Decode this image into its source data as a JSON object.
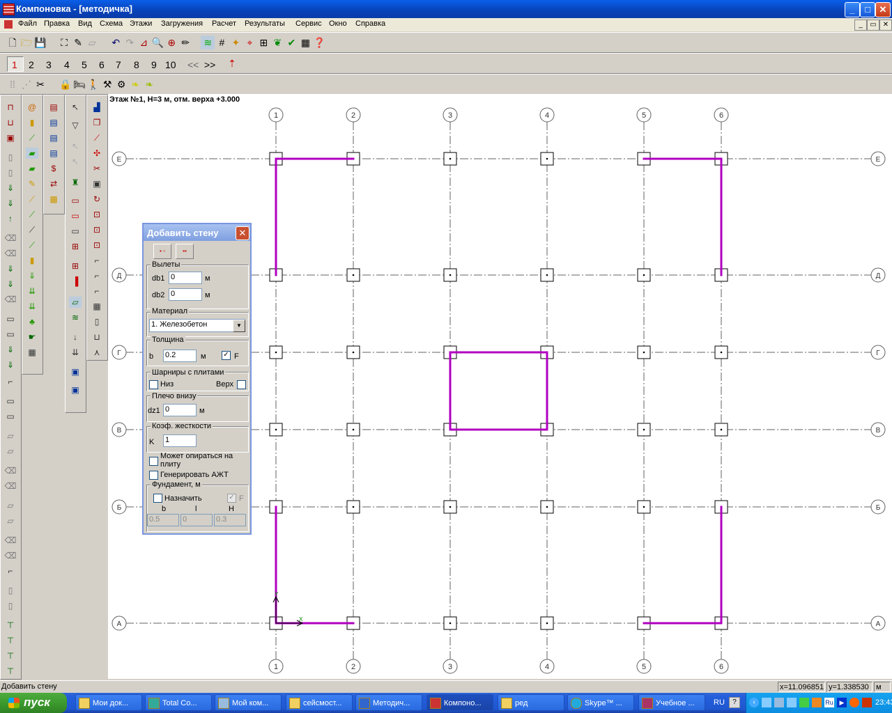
{
  "window": {
    "title": "Компоновка - [методичка]",
    "min": "_",
    "max": "□",
    "close": "✕"
  },
  "menu": [
    "Файл",
    "Правка",
    "Вид",
    "Схема",
    "Этажи",
    "Загружения",
    "Расчет",
    "Результаты",
    "Сервис",
    "Окно",
    "Справка"
  ],
  "floor_buttons": [
    "1",
    "2",
    "3",
    "4",
    "5",
    "6",
    "7",
    "8",
    "9",
    "10",
    "<<",
    ">>"
  ],
  "floor_info": "Этаж №1, H=3 м, отм. верха +3.000",
  "grid": {
    "x_axes": [
      "1",
      "2",
      "3",
      "4",
      "5",
      "6"
    ],
    "y_axes": [
      "Е",
      "Д",
      "Г",
      "В",
      "Б",
      "А"
    ],
    "wall_color": "#b000c0"
  },
  "dialog": {
    "title": "Добавить стену",
    "overhangs": {
      "label": "Вылеты",
      "db1_label": "db1",
      "db1": "0",
      "db2_label": "db2",
      "db2": "0",
      "unit": "м"
    },
    "material": {
      "label": "Материал",
      "value": "1. Железобетон"
    },
    "thickness": {
      "label": "Толщина",
      "b_label": "b",
      "b": "0.2",
      "unit": "м",
      "f_label": "F",
      "f_checked": "✓"
    },
    "hinges": {
      "label": "Шарниры с плитами",
      "bottom": "Низ",
      "top": "Верх"
    },
    "arm": {
      "label": "Плечо внизу",
      "dz1_label": "dz1",
      "dz1": "0",
      "unit": "м"
    },
    "stiffness": {
      "label": "Коэф. жесткости",
      "k_label": "K",
      "k": "1"
    },
    "can_rest": "Может опираться на плиту",
    "gen_azht": "Генерировать АЖТ",
    "foundation": {
      "label": "Фундамент, м",
      "assign": "Назначить",
      "f_label": "F",
      "f_checked": "✓",
      "b_label": "b",
      "l_label": "l",
      "h_label": "H",
      "b": "0.5",
      "l": "0",
      "h": "0.3"
    }
  },
  "status": {
    "text": "Добавить стену",
    "x": "x=11.096851",
    "y": "y=1.338530",
    "unit": "м"
  },
  "taskbar": {
    "start": "пуск",
    "tasks": [
      "Мои док...",
      "Total Co...",
      "Мой ком...",
      "сейсмост...",
      "Методич...",
      "Компоно...",
      "ред",
      "Skype™ ...",
      "Учебное ..."
    ],
    "lang": "RU",
    "clock": "23:43"
  }
}
